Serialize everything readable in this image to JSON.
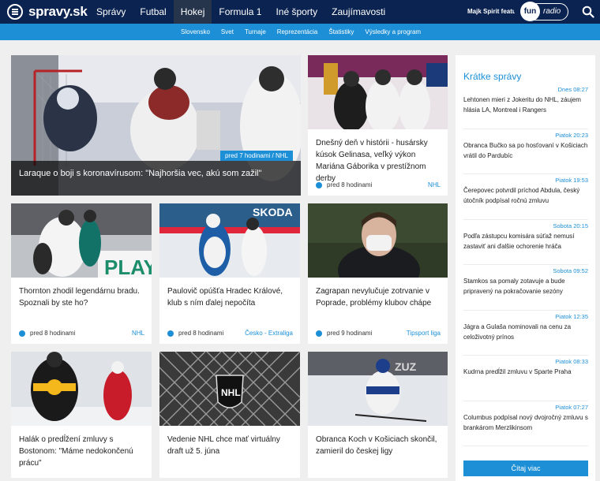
{
  "header": {
    "logo": "spravy.sk",
    "nav": [
      "Správy",
      "Futbal",
      "Hokej",
      "Formula 1",
      "Iné športy",
      "Zaujímavosti"
    ],
    "active_nav": "Hokej",
    "promo": "Majk Spirit featuring",
    "radio": {
      "fun": "fun",
      "radio": "radio"
    }
  },
  "subnav": [
    "Slovensko",
    "Svet",
    "Turnaje",
    "Reprezentácia",
    "Štatistiky",
    "Výsledky a program"
  ],
  "hero": {
    "meta": "pred 7 hodinami / NHL",
    "title": "Laraque o boji s koronavírusom: \"Najhoršia vec, akú som zažil\""
  },
  "cards": [
    {
      "title": "Dnešný deň v histórii - husársky kúsok Gelinasa, veľký výkon Mariána Gáborika v prestížnom derby",
      "time": "pred 8 hodinami",
      "tag": "NHL"
    },
    {
      "title": "Thornton zhodil legendárnu bradu. Spoznali by ste ho?",
      "time": "pred 8 hodinami",
      "tag": "NHL"
    },
    {
      "title": "Paulovič opúšťa Hradec Králové, klub s ním ďalej nepočíta",
      "time": "pred 8 hodinami",
      "tag": "Česko - Extraliga"
    },
    {
      "title": "Zagrapan nevylučuje zotrvanie v Poprade, problémy klubov chápe",
      "time": "pred 9 hodinami",
      "tag": "Tipsport liga"
    },
    {
      "title": "Halák o predĺžení zmluvy s Bostonom: \"Máme nedokončenú prácu\"",
      "time": "",
      "tag": ""
    },
    {
      "title": "Vedenie NHL chce mať virtuálny draft už 5. júna",
      "time": "",
      "tag": ""
    },
    {
      "title": "Obranca Koch v Košiciach skončil, zamieril do českej ligy",
      "time": "",
      "tag": ""
    }
  ],
  "sidebar": {
    "heading": "Krátke správy",
    "items": [
      {
        "time": "Dnes 08:27",
        "text": "Lehtonen mieri z Jokeritu do NHL, záujem hlásia LA, Montreal i Rangers"
      },
      {
        "time": "Piatok 20:23",
        "text": "Obranca Bučko sa po hosťovaní v Košiciach vrátil do Pardubíc"
      },
      {
        "time": "Piatok 19:53",
        "text": "Čerepovec potvrdil príchod Abdula, český útočník podpísal ročnú zmluvu"
      },
      {
        "time": "Sobota 20:15",
        "text": "Podľa zástupcu komisára súťaž nemusí zastaviť ani ďalšie ochorenie hráča"
      },
      {
        "time": "Sobota 09:52",
        "text": "Stamkos sa pomaly zotavuje a bude pripravený na pokračovanie sezóny"
      },
      {
        "time": "Piatok 12:35",
        "text": "Jágra a Gulaša nominovali na cenu za celoživotný prínos"
      },
      {
        "time": "Piatok 08:33",
        "text": "Kudrna predĺžil zmluvu v Sparte Praha"
      },
      {
        "time": "Piatok 07:27",
        "text": "Columbus podpísal nový dvojročný zmluvu s brankárom Merzlikinsom"
      }
    ],
    "read_more": "Čítaj viac"
  },
  "colors": {
    "navy": "#0b2350",
    "blue": "#1c8fd6"
  }
}
